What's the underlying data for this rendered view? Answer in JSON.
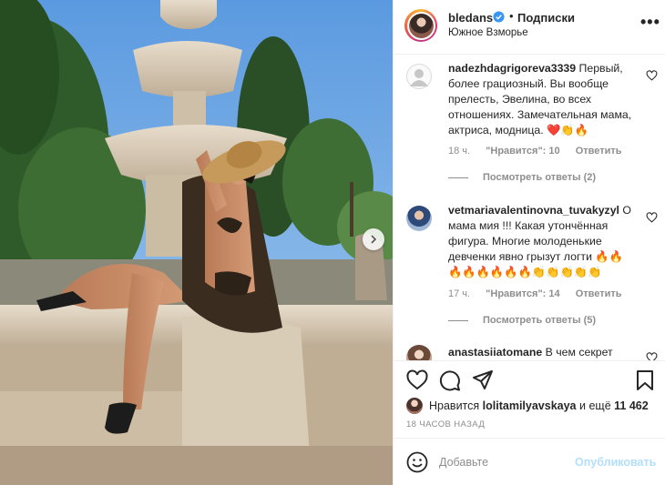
{
  "header": {
    "username": "bledans",
    "separator": "•",
    "follow_label": "Подписки",
    "location": "Южное Взморье",
    "more_label": "•••"
  },
  "comments": [
    {
      "username": "nadezhdagrigoreva3339",
      "text": "Первый, более грациозный. Вы вообще прелесть, Эвелина, во всех отношениях. Замечательная мама, актриса, модница. ❤️👏🔥",
      "time": "18 ч.",
      "likes": "\"Нравится\": 10",
      "reply_label": "Ответить",
      "view_replies": "Посмотреть ответы (2)"
    },
    {
      "username": "vetmariavalentinovna_tuvakyzyl",
      "text": "О мама мия !!! Какая утончённая фигура. Многие молоденькие девченки явно грызут логти 🔥🔥🔥🔥🔥🔥🔥🔥👏👏👏👏👏",
      "time": "17 ч.",
      "likes": "\"Нравится\": 14",
      "reply_label": "Ответить",
      "view_replies": "Посмотреть ответы (5)"
    },
    {
      "username": "anastasiiatomane",
      "text": "В чем секрет"
    }
  ],
  "likes_row": {
    "prefix": "Нравится",
    "user": "lolitamilyavskaya",
    "middle": "и ещё",
    "count": "11 462"
  },
  "time_ago": "18 ЧАСОВ НАЗАД",
  "add_comment": {
    "placeholder": "Добавьте",
    "publish_label": "Опубликовать"
  },
  "colors": {
    "verified": "#3897f0",
    "publish_disabled": "#b2dffc",
    "like_red": "#ed4956"
  },
  "icons": [
    "heart-icon",
    "comment-icon",
    "share-icon",
    "bookmark-icon",
    "smile-icon",
    "chevron-right-icon",
    "verified-badge-icon"
  ]
}
